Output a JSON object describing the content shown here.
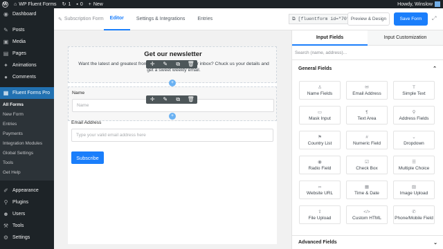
{
  "admin_bar": {
    "site_name": "WP Fluent Forms",
    "updates_count": "1",
    "comments_count": "0",
    "new_label": "New",
    "greeting": "Howdy, Winslow"
  },
  "sidebar": {
    "items_top": [
      {
        "label": "Dashboard",
        "icon": "dashboard-icon",
        "glyph": "◉"
      }
    ],
    "items_mid": [
      {
        "label": "Posts",
        "icon": "pin-icon",
        "glyph": "✎"
      },
      {
        "label": "Media",
        "icon": "media-icon",
        "glyph": "▣"
      },
      {
        "label": "Pages",
        "icon": "pages-icon",
        "glyph": "▤"
      },
      {
        "label": "Animations",
        "icon": "animation-icon",
        "glyph": "✦"
      },
      {
        "label": "Comments",
        "icon": "comment-icon",
        "glyph": "●"
      }
    ],
    "active": {
      "label": "Fluent Forms Pro",
      "icon": "fluent-forms-icon",
      "glyph": "▦"
    },
    "submenu": [
      {
        "label": "All Forms",
        "current": true
      },
      {
        "label": "New Form"
      },
      {
        "label": "Entries"
      },
      {
        "label": "Payments"
      },
      {
        "label": "Integration Modules"
      },
      {
        "label": "Global Settings"
      },
      {
        "label": "Tools"
      },
      {
        "label": "Get Help"
      }
    ],
    "items_bottom": [
      {
        "label": "Appearance",
        "icon": "brush-icon",
        "glyph": "✐"
      },
      {
        "label": "Plugins",
        "icon": "plug-icon",
        "glyph": "⚲"
      },
      {
        "label": "Users",
        "icon": "user-icon",
        "glyph": "☻"
      },
      {
        "label": "Tools",
        "icon": "wrench-icon",
        "glyph": "⚒"
      },
      {
        "label": "Settings",
        "icon": "settings-icon",
        "glyph": "⚙"
      }
    ]
  },
  "editor_header": {
    "breadcrumb": "Subscription Form",
    "tabs": [
      "Editor",
      "Settings & Integrations",
      "Entries"
    ],
    "active_tab": "Editor",
    "shortcode": "[fluentform id=\"70\"]",
    "preview_label": "Preview & Design",
    "save_label": "Save Form"
  },
  "form": {
    "title": "Get our newsletter",
    "description": "Want the latest and greatest from our blog straight to your inbox? Chuck us your details and get a sweet weekly email.",
    "name_label": "Name",
    "name_placeholder": "Name",
    "email_label": "Email Address",
    "email_placeholder": "Type your valid email address here",
    "submit_label": "Subscribe"
  },
  "panel": {
    "tabs": [
      "Input Fields",
      "Input Customization"
    ],
    "active_tab": "Input Fields",
    "search_placeholder": "Search (name, address)...",
    "general_heading": "General Fields",
    "fields": [
      {
        "label": "Name Fields",
        "icon": "person-icon",
        "glyph": "♙"
      },
      {
        "label": "Email Address",
        "icon": "envelope-icon",
        "glyph": "✉"
      },
      {
        "label": "Simple Text",
        "icon": "text-icon",
        "glyph": "T"
      },
      {
        "label": "Mask Input",
        "icon": "mask-icon",
        "glyph": "▭"
      },
      {
        "label": "Text Area",
        "icon": "textarea-icon",
        "glyph": "¶"
      },
      {
        "label": "Address Fields",
        "icon": "location-icon",
        "glyph": "⚲"
      },
      {
        "label": "Country List",
        "icon": "flag-icon",
        "glyph": "⚑"
      },
      {
        "label": "Numeric Field",
        "icon": "hash-icon",
        "glyph": "#"
      },
      {
        "label": "Dropdown",
        "icon": "dropdown-icon",
        "glyph": "⌄"
      },
      {
        "label": "Radio Field",
        "icon": "radio-icon",
        "glyph": "◉"
      },
      {
        "label": "Check Box",
        "icon": "checkbox-icon",
        "glyph": "☑"
      },
      {
        "label": "Multiple Choice",
        "icon": "list-icon",
        "glyph": "☰"
      },
      {
        "label": "Website URL",
        "icon": "link-icon",
        "glyph": "∞"
      },
      {
        "label": "Time & Date",
        "icon": "calendar-icon",
        "glyph": "▦"
      },
      {
        "label": "Image Upload",
        "icon": "image-icon",
        "glyph": "▨"
      },
      {
        "label": "File Upload",
        "icon": "upload-icon",
        "glyph": "⇪"
      },
      {
        "label": "Custom HTML",
        "icon": "code-icon",
        "glyph": "</>"
      },
      {
        "label": "Phone/Mobile Field",
        "icon": "phone-icon",
        "glyph": "✆"
      }
    ],
    "advanced_heading": "Advanced Fields"
  }
}
